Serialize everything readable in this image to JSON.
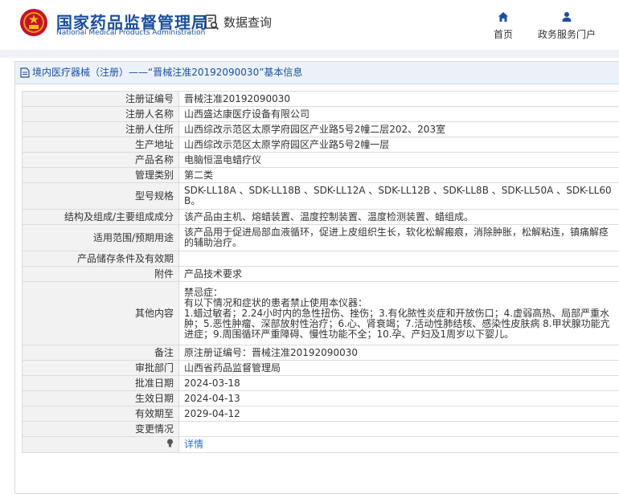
{
  "header": {
    "site_title": "国家药品监督管理局",
    "site_subtitle": "National Medical Products Administration",
    "query_label": "数据查询",
    "nav": [
      {
        "label": "首页",
        "icon": "home-icon"
      },
      {
        "label": "政务服务门户",
        "icon": "user-icon"
      }
    ]
  },
  "panel": {
    "title": "境内医疗器械（注册）——“晋械注准20192090030”基本信息"
  },
  "rows": [
    {
      "label": "注册证编号",
      "value": "晋械注准20192090030"
    },
    {
      "label": "注册人名称",
      "value": "山西盛达康医疗设备有限公司"
    },
    {
      "label": "注册人住所",
      "value": "山西综改示范区太原学府园区产业路5号2幢二层202、203室"
    },
    {
      "label": "生产地址",
      "value": "山西综改示范区太原学府园区产业路5号2幢一层"
    },
    {
      "label": "产品名称",
      "value": "电脑恒温电蜡疗仪"
    },
    {
      "label": "管理类别",
      "value": "第二类"
    },
    {
      "label": "型号规格",
      "value": "SDK-LL18A 、SDK-LL18B 、SDK-LL12A 、SDK-LL12B 、SDK-LL8B 、SDK-LL50A 、SDK-LL60B。"
    },
    {
      "label": "结构及组成/主要组成成分",
      "value": "该产品由主机、熔蜡装置、温度控制装置、温度检测装置、蜡组成。"
    },
    {
      "label": "适用范围/预期用途",
      "value": "该产品用于促进局部血液循环，促进上皮组织生长，软化松解瘢痕，消除肿胀，松解粘连，镇痛解痉的辅助治疗。"
    },
    {
      "label": "产品储存条件及有效期",
      "value": ""
    },
    {
      "label": "附件",
      "value": "产品技术要求"
    },
    {
      "label": "其他内容",
      "value": "禁忌症：\n有以下情况和症状的患者禁止使用本仪器：\n1.蜡过敏者；2.24小时内的急性扭伤、挫伤；3.有化脓性炎症和开放伤口；4.虚弱高热、局部严重水肿；5.恶性肿瘤、深部放射性治疗；6.心、肾衰竭；7.活动性肺结核、感染性皮肤病 8.甲状腺功能亢进症；9.周围循环严重障碍、慢性功能不全；10.孕、产妇及1周岁以下婴儿。"
    },
    {
      "label": "备注",
      "value": "原注册证编号：晋械注准20192090030"
    },
    {
      "label": "审批部门",
      "value": "山西省药品监督管理局"
    },
    {
      "label": "批准日期",
      "value": "2024-03-18"
    },
    {
      "label": "生效日期",
      "value": "2024-04-13"
    },
    {
      "label": "有效期至",
      "value": "2029-04-12"
    },
    {
      "label": "变更情况",
      "value": ""
    }
  ],
  "detail_row": {
    "label": "",
    "value": "详情",
    "icon": "lightbulb-icon"
  },
  "colors": {
    "brand": "#1a4fa0",
    "link": "#2a6fd6",
    "label_bg": "#f2f2f2"
  }
}
